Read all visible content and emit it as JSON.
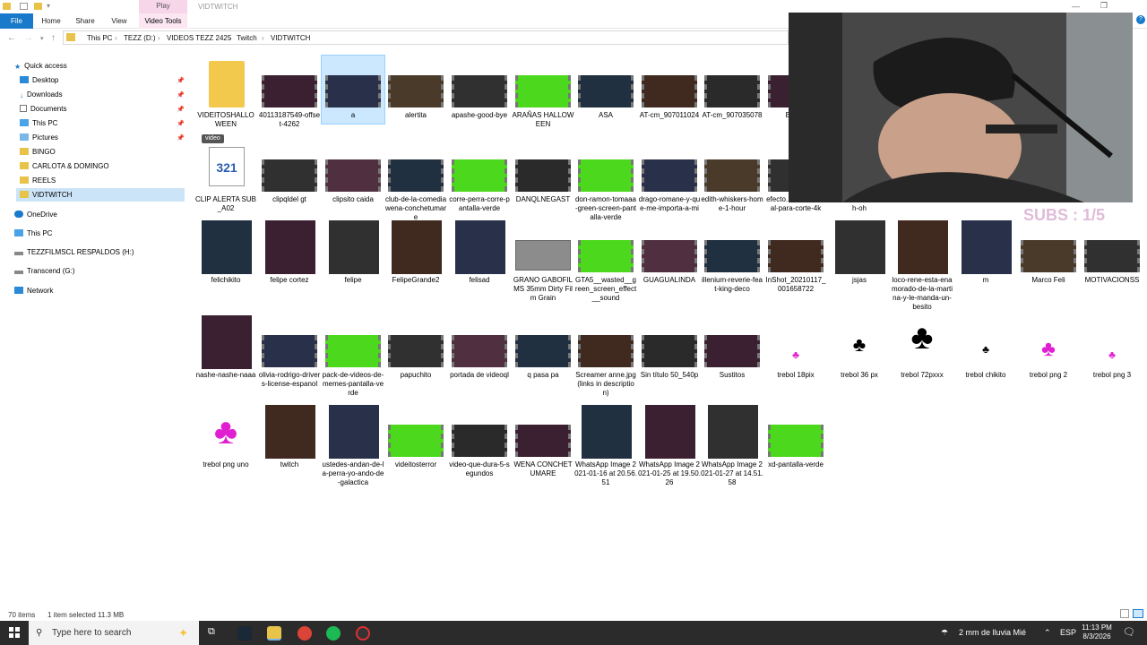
{
  "window": {
    "title": "VIDTWITCH",
    "contextual_tab": "Play",
    "ribbon_tabs": [
      "File",
      "Home",
      "Share",
      "View",
      "Video Tools"
    ]
  },
  "address": {
    "crumbs": [
      "This PC",
      "TEZZ (D:)",
      "VIDEOS TEZZ 2425",
      "Twitch",
      "VIDTWITCH"
    ]
  },
  "nav": {
    "quick_access": "Quick access",
    "items": [
      {
        "label": "Desktop",
        "pinned": true
      },
      {
        "label": "Downloads",
        "pinned": true
      },
      {
        "label": "Documents",
        "pinned": true
      },
      {
        "label": "This PC",
        "pinned": true
      },
      {
        "label": "Pictures",
        "pinned": true
      },
      {
        "label": "BINGO"
      },
      {
        "label": "CARLOTA & DOMINGO"
      },
      {
        "label": "REELS"
      },
      {
        "label": "VIDTWITCH",
        "selected": true
      }
    ],
    "onedrive": "OneDrive",
    "thispc": "This PC",
    "drive_h": "TEZZFILMSCL RESPALDOS (H:)",
    "drive_g": "Transcend (G:)",
    "network": "Network"
  },
  "files": {
    "row1": [
      "VIDEITOSHALLOWEEN",
      "40113187549-offset-4262",
      "a",
      "alertita",
      "apashe-good-bye",
      "ARAÑAS HALLOWEEN",
      "ASA",
      "AT-cm_907011024",
      "AT-cm_907035078",
      "BAILE"
    ],
    "row2": [
      "CLIP ALERTA SUB_A02",
      "clipqldel gt",
      "clipsito caida",
      "club-de-la-comediawena-conchetumare",
      "corre-perra-corre-pantalla-verde",
      "DANQLNEGAST",
      "don-ramon-tomaaa-green-screen-pantalla-verde",
      "drago-romane-y-que-me-importa-a-mi",
      "edith-whiskers-home-1-hour",
      "efecto...on-sin-señal-para-corte-4k"
    ],
    "row2_extra": "a-verde-de-oh-oh-oh-oh",
    "row3": [
      "felichikito",
      "felipe cortez",
      "felipe",
      "FelipeGrande2",
      "felisad",
      "GRANO GABOFILMS 35mm Dirty Film Grain",
      "GTA5__wasted__green_screen_effect__sound",
      "GUAGUALINDA",
      "illenium-reverie-feat-king-deco",
      "InShot_20210117_001658722",
      "jsjas",
      "loco-rene-esta-enamorado-de-la-martina-y-le-manda-un-besito",
      "m",
      "Marco Feli",
      "MOTIVACIONSS"
    ],
    "row4": [
      "nashe-nashe-naaa",
      "olivia-rodrigo-drivers-license-espanol",
      "pack-de-videos-de-memes-pantalla-verde",
      "papuchito",
      "portada de videoql",
      "q pasa pa",
      "Screamer anne.jpg (links in description)",
      "Sin título 50_540p",
      "Sustitos",
      "trebol 18pix",
      "trebol 36 px",
      "trebol 72pxxx",
      "trebol chikito",
      "trebol png 2",
      "trebol png 3"
    ],
    "row5": [
      "trebol png uno",
      "twitch",
      "ustedes-andan-de-la-perra-yo-ando-de-galactica",
      "videitosterror",
      "video-que-dura-5-segundos",
      "WENA CONCHETUMARE",
      "WhatsApp Image 2021-01-16 at 20.56.51",
      "WhatsApp Image 2021-01-25 at 19.50.26",
      "WhatsApp Image 2021-01-27 at 14.51.58",
      "xd-pantalla-verde"
    ],
    "video_badge": "video"
  },
  "overlay": {
    "subs": "SUBS : 1/5"
  },
  "status": {
    "count": "70 items",
    "selection": "1 item selected  11.3 MB"
  },
  "taskbar": {
    "search_placeholder": "Type here to search",
    "weather": "2 mm de lluvia Mié",
    "lang": "ESP",
    "time": "11:13 PM",
    "date": "8/3/2026"
  },
  "colors": {
    "accent": "#1979ca",
    "green_screen": "#4cd81c",
    "clover": "#e020d0",
    "selected": "#cce8ff"
  }
}
